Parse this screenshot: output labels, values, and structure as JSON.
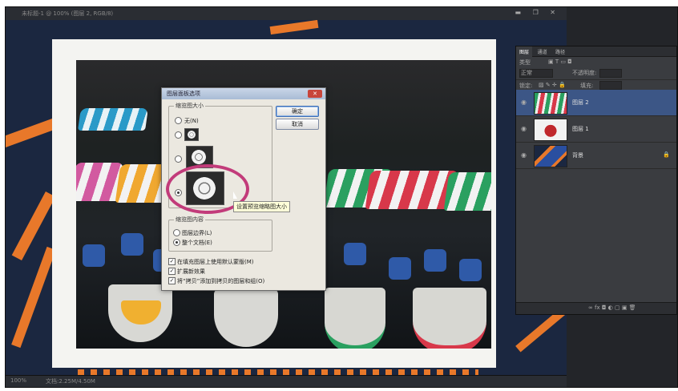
{
  "app": {
    "title": "未标题-1 @ 100% (图层 2, RGB/8)",
    "window_controls": "▬ ❐ ✕",
    "zoom": "100%",
    "doc_info": "文档:2.25M/4.50M"
  },
  "dialog": {
    "title": "图层面板选项",
    "close_glyph": "✕",
    "thumb_group_label": "缩览图大小",
    "thumb_options": [
      "无(N)",
      "",
      "",
      ""
    ],
    "selected_thumb_index": 3,
    "ok_label": "确定",
    "cancel_label": "取消",
    "content_group_label": "缩览图内容",
    "content_options": [
      "图层边界(L)",
      "整个文档(E)"
    ],
    "selected_content_index": 1,
    "checkboxes": [
      {
        "label": "在填充图层上使用默认蒙版(M)",
        "checked": true
      },
      {
        "label": "扩展新效果",
        "checked": true
      },
      {
        "label": "将“拷贝”添加到拷贝的图层和组(O)",
        "checked": true
      }
    ],
    "tooltip": "设置预览缩略图大小"
  },
  "layers_panel": {
    "tabs": [
      "图层",
      "通道",
      "路径"
    ],
    "active_tab": 0,
    "kind_label": "类型",
    "mode_label": "正常",
    "opacity_label": "不透明度:",
    "lock_label": "锁定:",
    "fill_label": "填充:",
    "layers": [
      {
        "name": "图层 2",
        "selected": true,
        "thumb": "boats"
      },
      {
        "name": "图层 1",
        "selected": false,
        "thumb": "teapot"
      },
      {
        "name": "背景",
        "selected": false,
        "thumb": "abstract",
        "locked": true
      }
    ],
    "footer_icons": "∞ fx ◘ ◐ ▢ ▣ 🗑"
  },
  "colors": {
    "accent": "#3c5686",
    "highlight_ring": "#c23b7a",
    "stripe": "#e8782a"
  }
}
